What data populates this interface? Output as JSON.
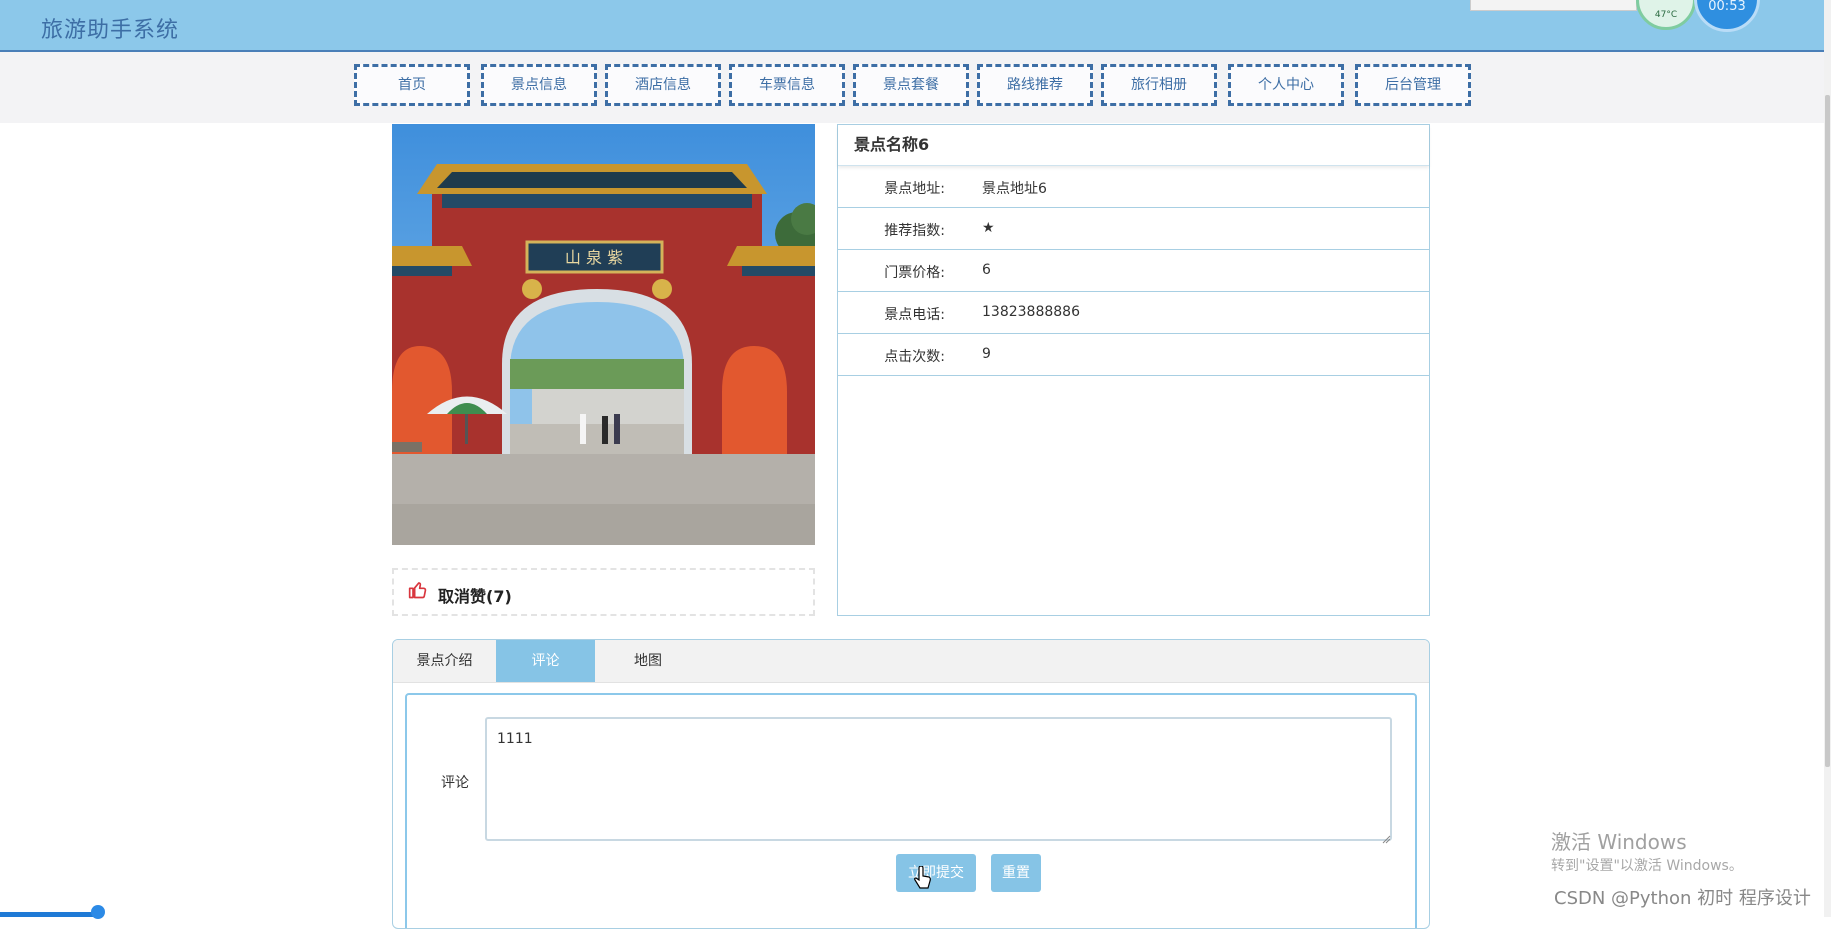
{
  "header": {
    "title": "旅游助手系统",
    "temperature": "47°C",
    "clock": "00:53"
  },
  "nav": {
    "items": [
      {
        "label": "首页"
      },
      {
        "label": "景点信息"
      },
      {
        "label": "酒店信息"
      },
      {
        "label": "车票信息"
      },
      {
        "label": "景点套餐"
      },
      {
        "label": "路线推荐"
      },
      {
        "label": "旅行相册"
      },
      {
        "label": "个人中心"
      },
      {
        "label": "后台管理"
      }
    ]
  },
  "like": {
    "label": "取消赞(7)"
  },
  "info": {
    "title": "景点名称6",
    "rows": [
      {
        "label": "景点地址:",
        "value": "景点地址6"
      },
      {
        "label": "推荐指数:",
        "value": "★"
      },
      {
        "label": "门票价格:",
        "value": "6"
      },
      {
        "label": "景点电话:",
        "value": "13823888886"
      },
      {
        "label": "点击次数:",
        "value": "9"
      }
    ]
  },
  "tabs": {
    "items": [
      {
        "label": "景点介绍"
      },
      {
        "label": "评论"
      },
      {
        "label": "地图"
      }
    ],
    "active": "评论"
  },
  "comment": {
    "label": "评论",
    "value": "1111",
    "submit_label": "立即提交",
    "reset_label": "重置"
  },
  "watermark": {
    "activate_title": "激活 Windows",
    "activate_sub": "转到\"设置\"以激活 Windows。",
    "csdn": "CSDN @Python 初时 程序设计"
  },
  "colors": {
    "header_bg": "#8cc8ea",
    "accent": "#3d6ea5",
    "tab_active": "#86c4e6",
    "like_icon": "#d9363e"
  }
}
